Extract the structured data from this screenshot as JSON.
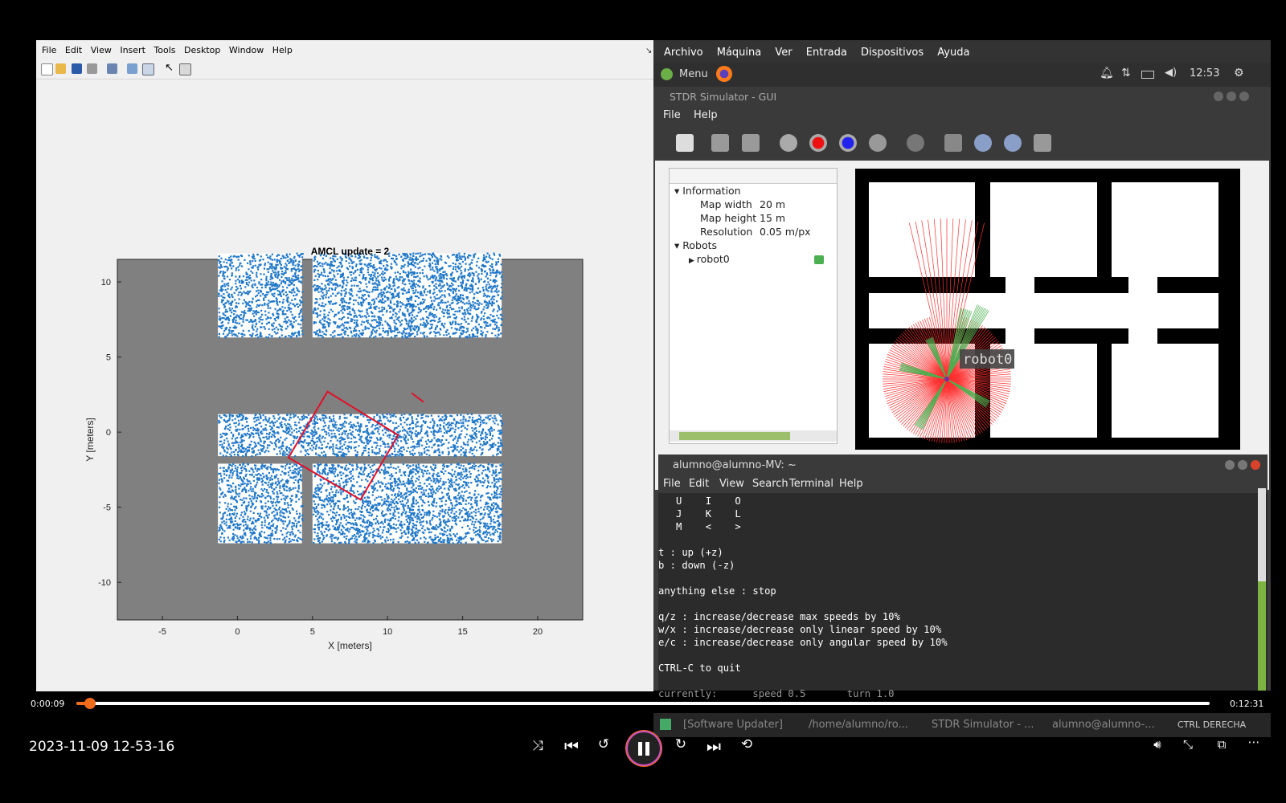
{
  "matlab": {
    "menu": [
      "File",
      "Edit",
      "View",
      "Insert",
      "Tools",
      "Desktop",
      "Window",
      "Help"
    ],
    "figure": {
      "title": "AMCL update = 2",
      "xlabel": "X [meters]",
      "ylabel": "Y [meters]",
      "xticks": [
        "-5",
        "0",
        "5",
        "10",
        "15",
        "20"
      ],
      "yticks": [
        "10",
        "5",
        "0",
        "-5",
        "-10"
      ]
    }
  },
  "chart_data": {
    "type": "scatter",
    "title": "AMCL update = 2",
    "xlabel": "X [meters]",
    "ylabel": "Y [meters]",
    "xlim": [
      -8,
      23
    ],
    "ylim": [
      -12.5,
      11.5
    ],
    "xticks": [
      -5,
      0,
      5,
      10,
      15,
      20
    ],
    "yticks": [
      10,
      5,
      0,
      -5,
      -10
    ],
    "grid": false,
    "series": [
      {
        "kind": "particles",
        "color": "#1f77c8"
      },
      {
        "kind": "robot-pose-box",
        "color": "#e0102a",
        "corners": [
          [
            3.4,
            -1.7
          ],
          [
            6.0,
            2.7
          ],
          [
            10.7,
            -0.2
          ],
          [
            8.2,
            -4.5
          ]
        ]
      },
      {
        "kind": "heading-segment",
        "color": "#e0102a",
        "points": [
          [
            11.6,
            2.6
          ],
          [
            12.4,
            2.0
          ]
        ]
      }
    ]
  },
  "virtualbox": {
    "menu": [
      "Archivo",
      "Máquina",
      "Ver",
      "Entrada",
      "Dispositivos",
      "Ayuda"
    ],
    "panel_menu": "Menu",
    "clock": "12:53"
  },
  "stdr": {
    "title": "STDR Simulator - GUI",
    "menu": [
      "File",
      "Help"
    ],
    "tree": {
      "info_header": "Information",
      "rows": [
        {
          "key": "Map width",
          "value": "20 m"
        },
        {
          "key": "Map height",
          "value": "15 m"
        },
        {
          "key": "Resolution",
          "value": "0.05 m/px"
        }
      ],
      "robots_header": "Robots",
      "robot": "robot0"
    },
    "robot_label": "robot0"
  },
  "terminal": {
    "title": "alumno@alumno-MV: ~",
    "menu": [
      "File",
      "Edit",
      "View",
      "Search",
      "Terminal",
      "Help"
    ],
    "lines": [
      "   U    I    O",
      "   J    K    L",
      "   M    <    >",
      "",
      "t : up (+z)",
      "b : down (-z)",
      "",
      "anything else : stop",
      "",
      "q/z : increase/decrease max speeds by 10%",
      "w/x : increase/decrease only linear speed by 10%",
      "e/c : increase/decrease only angular speed by 10%",
      "",
      "CTRL-C to quit",
      "",
      "currently:      speed 0.5       turn 1.0"
    ]
  },
  "taskbar": {
    "items": [
      "[Software Updater]",
      "/home/alumno/ro...",
      "STDR Simulator - ...",
      "alumno@alumno-..."
    ],
    "tray_text": "CTRL DERECHA"
  },
  "player": {
    "elapsed": "0:00:09",
    "duration": "0:12:31",
    "progress_fraction": 0.012,
    "timestamp": "2023-11-09 12-53-16"
  }
}
